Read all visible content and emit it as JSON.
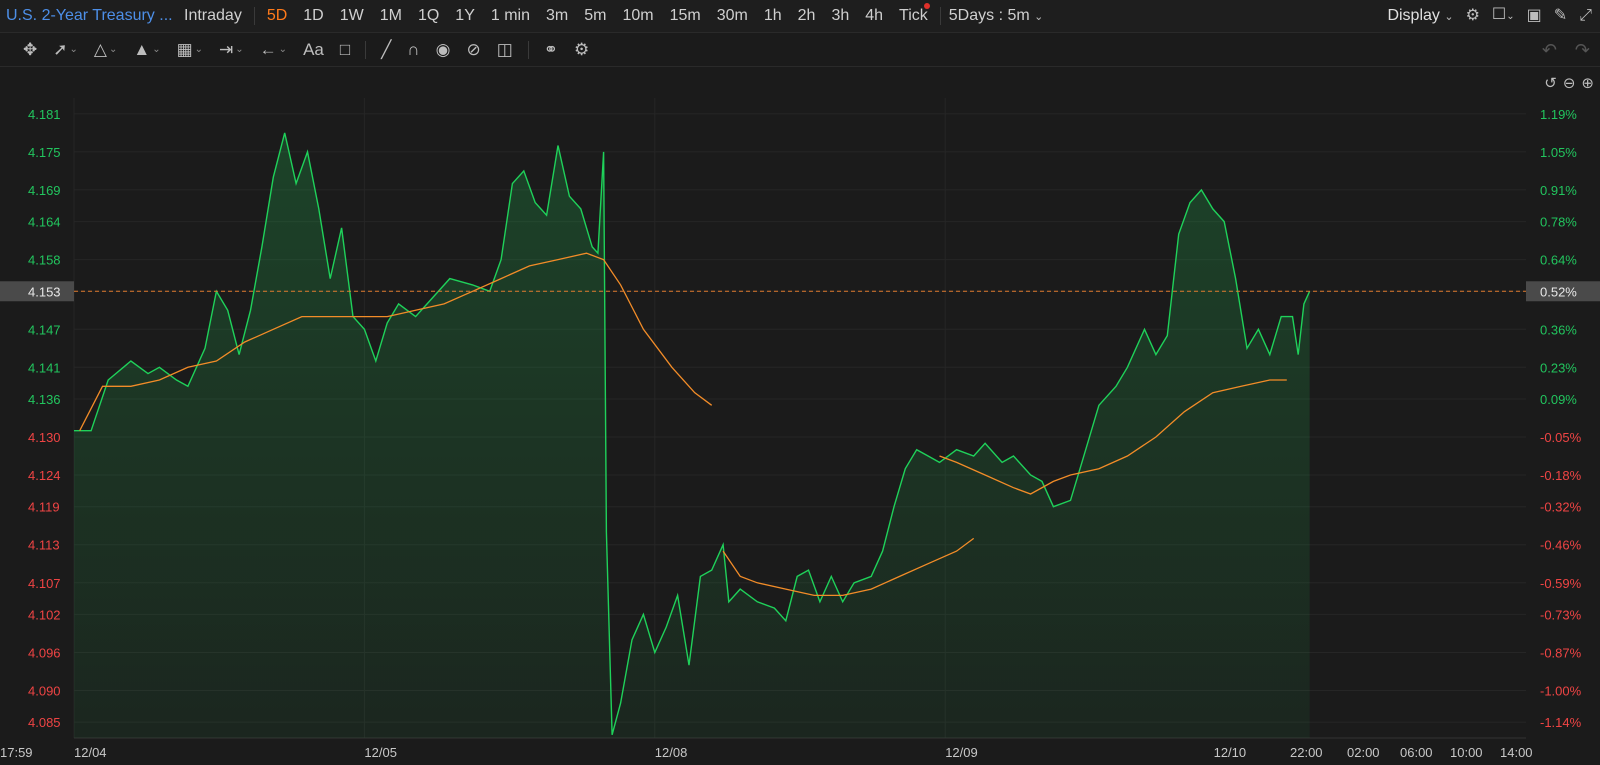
{
  "header": {
    "symbol": "U.S. 2-Year Treasury ...",
    "periods": [
      "Intraday",
      "5D",
      "1D",
      "1W",
      "1M",
      "1Q",
      "1Y",
      "1 min",
      "3m",
      "5m",
      "10m",
      "15m",
      "30m",
      "1h",
      "2h",
      "3h",
      "4h",
      "Tick"
    ],
    "active_period": "5D",
    "range_selector": "5Days : 5m",
    "display_label": "Display"
  },
  "toolbar": {
    "tools": [
      "move-icon",
      "line-tool-icon",
      "fib-tool-icon",
      "pattern-tool-icon",
      "measure-tool-icon",
      "range-tool-icon",
      "arrow-tool-icon",
      "text-tool-icon",
      "note-tool-icon",
      "pen-icon",
      "magnet-icon",
      "visibility-icon",
      "hide-icon",
      "trash-icon",
      "link-icon",
      "settings-icon"
    ],
    "text_tool_label": "Aa"
  },
  "colors": {
    "background": "#1b1b1b",
    "price_line": "#1fd15a",
    "moving_average": "#f28c28",
    "up_label": "#22c55e",
    "down_label": "#ef4444",
    "current_price_line": "#e07b2e"
  },
  "chart_data": {
    "type": "line",
    "title": "U.S. 2-Year Treasury ...",
    "current_price": "4.153",
    "current_change": "0.52%",
    "y_ticks": [
      "4.181",
      "4.175",
      "4.169",
      "4.164",
      "4.158",
      "4.153",
      "4.147",
      "4.141",
      "4.136",
      "4.130",
      "4.124",
      "4.119",
      "4.113",
      "4.107",
      "4.102",
      "4.096",
      "4.090",
      "4.085"
    ],
    "pct_ticks": [
      "1.19%",
      "1.05%",
      "0.91%",
      "0.78%",
      "0.64%",
      "0.52%",
      "0.36%",
      "0.23%",
      "0.09%",
      "-0.05%",
      "-0.18%",
      "-0.32%",
      "-0.46%",
      "-0.59%",
      "-0.73%",
      "-0.87%",
      "-1.00%",
      "-1.14%"
    ],
    "x_ticks": [
      "12/04",
      "12/05",
      "12/08",
      "12/09",
      "12/10",
      "22:00",
      "02:00",
      "06:00",
      "10:00",
      "14:00",
      "17:59"
    ],
    "ylim": [
      4.0825,
      4.1835
    ],
    "series": [
      {
        "values": [
          [
            0,
            4.131
          ],
          [
            0.06,
            4.131
          ],
          [
            0.12,
            4.139
          ],
          [
            0.2,
            4.142
          ],
          [
            0.26,
            4.14
          ],
          [
            0.3,
            4.141
          ],
          [
            0.36,
            4.139
          ],
          [
            0.4,
            4.138
          ],
          [
            0.46,
            4.144
          ],
          [
            0.5,
            4.153
          ],
          [
            0.54,
            4.15
          ],
          [
            0.58,
            4.143
          ],
          [
            0.62,
            4.15
          ],
          [
            0.66,
            4.16
          ],
          [
            0.7,
            4.171
          ],
          [
            0.74,
            4.178
          ],
          [
            0.78,
            4.17
          ],
          [
            0.82,
            4.175
          ],
          [
            0.86,
            4.166
          ],
          [
            0.9,
            4.155
          ],
          [
            0.94,
            4.163
          ],
          [
            0.98,
            4.149
          ],
          [
            1.02,
            4.147
          ],
          [
            1.06,
            4.142
          ],
          [
            1.1,
            4.148
          ],
          [
            1.14,
            4.151
          ],
          [
            1.2,
            4.149
          ],
          [
            1.26,
            4.152
          ],
          [
            1.32,
            4.155
          ],
          [
            1.4,
            4.154
          ],
          [
            1.46,
            4.153
          ],
          [
            1.5,
            4.158
          ],
          [
            1.54,
            4.17
          ],
          [
            1.58,
            4.172
          ],
          [
            1.62,
            4.167
          ],
          [
            1.66,
            4.165
          ],
          [
            1.7,
            4.176
          ],
          [
            1.74,
            4.168
          ],
          [
            1.78,
            4.166
          ],
          [
            1.82,
            4.16
          ],
          [
            1.84,
            4.159
          ],
          [
            1.86,
            4.175
          ],
          [
            1.87,
            4.115
          ],
          [
            1.89,
            4.083
          ],
          [
            1.92,
            4.088
          ],
          [
            1.96,
            4.098
          ],
          [
            2.0,
            4.102
          ],
          [
            2.04,
            4.096
          ],
          [
            2.08,
            4.1
          ],
          [
            2.12,
            4.105
          ],
          [
            2.16,
            4.094
          ],
          [
            2.2,
            4.108
          ],
          [
            2.24,
            4.109
          ],
          [
            2.28,
            4.113
          ],
          [
            2.3,
            4.104
          ],
          [
            2.34,
            4.106
          ],
          [
            2.4,
            4.104
          ],
          [
            2.46,
            4.103
          ],
          [
            2.5,
            4.101
          ],
          [
            2.54,
            4.108
          ],
          [
            2.58,
            4.109
          ],
          [
            2.62,
            4.104
          ],
          [
            2.66,
            4.108
          ],
          [
            2.7,
            4.104
          ],
          [
            2.74,
            4.107
          ],
          [
            2.8,
            4.108
          ],
          [
            2.84,
            4.112
          ],
          [
            2.88,
            4.119
          ],
          [
            2.92,
            4.125
          ],
          [
            2.96,
            4.128
          ],
          [
            3.0,
            4.127
          ],
          [
            3.04,
            4.126
          ],
          [
            3.1,
            4.128
          ],
          [
            3.16,
            4.127
          ],
          [
            3.2,
            4.129
          ],
          [
            3.26,
            4.126
          ],
          [
            3.3,
            4.127
          ],
          [
            3.36,
            4.124
          ],
          [
            3.4,
            4.123
          ],
          [
            3.44,
            4.119
          ],
          [
            3.5,
            4.12
          ],
          [
            3.54,
            4.126
          ],
          [
            3.6,
            4.135
          ],
          [
            3.66,
            4.138
          ],
          [
            3.7,
            4.141
          ],
          [
            3.76,
            4.147
          ],
          [
            3.8,
            4.143
          ],
          [
            3.84,
            4.146
          ],
          [
            3.88,
            4.162
          ],
          [
            3.92,
            4.167
          ],
          [
            3.96,
            4.169
          ],
          [
            4.0,
            4.166
          ],
          [
            4.04,
            4.164
          ],
          [
            4.08,
            4.155
          ],
          [
            4.12,
            4.144
          ],
          [
            4.16,
            4.147
          ],
          [
            4.2,
            4.143
          ],
          [
            4.24,
            4.149
          ],
          [
            4.28,
            4.149
          ],
          [
            4.3,
            4.143
          ],
          [
            4.32,
            4.151
          ],
          [
            4.34,
            4.153
          ]
        ]
      },
      {
        "values": [
          [
            0.02,
            4.131
          ],
          [
            0.1,
            4.138
          ],
          [
            0.2,
            4.138
          ],
          [
            0.3,
            4.139
          ],
          [
            0.4,
            4.141
          ],
          [
            0.5,
            4.142
          ],
          [
            0.6,
            4.145
          ],
          [
            0.7,
            4.147
          ],
          [
            0.8,
            4.149
          ],
          [
            0.9,
            4.149
          ],
          [
            1.0,
            4.149
          ],
          [
            1.1,
            4.149
          ],
          [
            1.2,
            4.15
          ],
          [
            1.3,
            4.151
          ],
          [
            1.4,
            4.153
          ],
          [
            1.5,
            4.155
          ],
          [
            1.6,
            4.157
          ],
          [
            1.7,
            4.158
          ],
          [
            1.8,
            4.159
          ],
          [
            1.86,
            4.158
          ],
          [
            1.92,
            4.154
          ],
          [
            2.0,
            4.147
          ],
          [
            2.1,
            4.141
          ],
          [
            2.18,
            4.137
          ],
          [
            2.24,
            4.135
          ]
        ]
      },
      {
        "values": [
          [
            2.28,
            4.112
          ],
          [
            2.34,
            4.108
          ],
          [
            2.4,
            4.107
          ],
          [
            2.5,
            4.106
          ],
          [
            2.6,
            4.105
          ],
          [
            2.7,
            4.105
          ],
          [
            2.8,
            4.106
          ],
          [
            2.9,
            4.108
          ],
          [
            3.0,
            4.11
          ],
          [
            3.1,
            4.112
          ],
          [
            3.16,
            4.114
          ]
        ]
      },
      {
        "values": [
          [
            3.04,
            4.127
          ],
          [
            3.1,
            4.126
          ],
          [
            3.2,
            4.124
          ],
          [
            3.3,
            4.122
          ],
          [
            3.36,
            4.121
          ],
          [
            3.44,
            4.123
          ],
          [
            3.5,
            4.124
          ],
          [
            3.6,
            4.125
          ],
          [
            3.7,
            4.127
          ],
          [
            3.8,
            4.13
          ],
          [
            3.9,
            4.134
          ],
          [
            4.0,
            4.137
          ],
          [
            4.1,
            4.138
          ],
          [
            4.2,
            4.139
          ],
          [
            4.26,
            4.139
          ]
        ]
      }
    ],
    "grid": true
  },
  "controls": {
    "undo": "undo-icon",
    "redo": "redo-icon"
  }
}
